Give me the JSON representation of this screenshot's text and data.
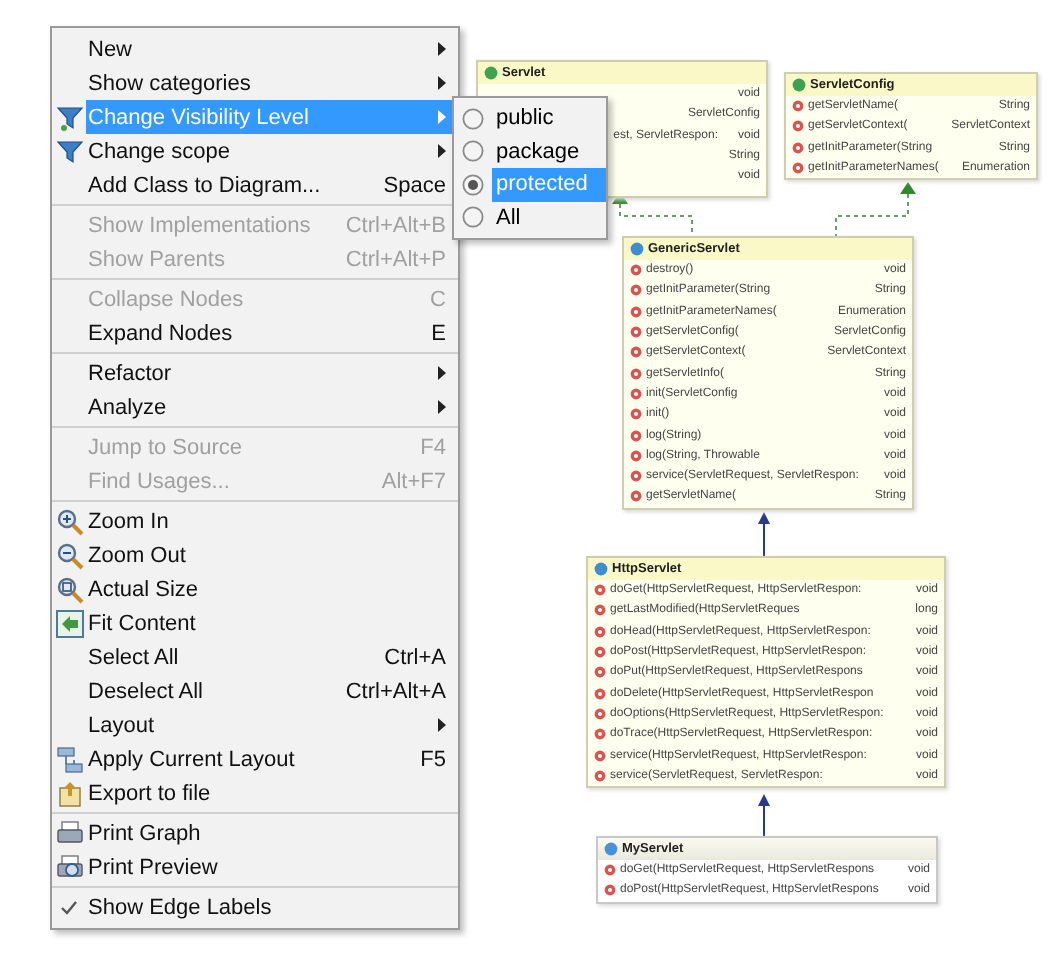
{
  "diagram": {
    "classes": [
      {
        "name": "Servlet",
        "kind": "interface",
        "members": [
          {
            "type": "void"
          },
          {
            "type": "ServletConfig"
          },
          {
            "name": "est, ServletRespon:",
            "type": "void"
          },
          {
            "type": "String"
          },
          {
            "type": "void"
          }
        ]
      },
      {
        "name": "ServletConfig",
        "kind": "interface",
        "members": [
          {
            "name": "getServletName(",
            "type": "String"
          },
          {
            "name": "getServletContext(",
            "type": "ServletContext"
          },
          {
            "name": "getInitParameter(String",
            "type": "String"
          },
          {
            "name": "getInitParameterNames(",
            "type": "Enumeration"
          }
        ]
      },
      {
        "name": "GenericServlet",
        "kind": "abstract",
        "members": [
          {
            "name": "destroy()",
            "type": "void"
          },
          {
            "name": "getInitParameter(String",
            "type": "String"
          },
          {
            "name": "getInitParameterNames(",
            "type": "Enumeration"
          },
          {
            "name": "getServletConfig(",
            "type": "ServletConfig"
          },
          {
            "name": "getServletContext(",
            "type": "ServletContext"
          },
          {
            "name": "getServletInfo(",
            "type": "String"
          },
          {
            "name": "init(ServletConfig",
            "type": "void"
          },
          {
            "name": "init()",
            "type": "void"
          },
          {
            "name": "log(String)",
            "type": "void"
          },
          {
            "name": "log(String, Throwable",
            "type": "void"
          },
          {
            "name": "service(ServletRequest, ServletRespon:",
            "type": "void"
          },
          {
            "name": "getServletName(",
            "type": "String"
          }
        ]
      },
      {
        "name": "HttpServlet",
        "kind": "abstract",
        "members": [
          {
            "name": "doGet(HttpServletRequest, HttpServletRespon:",
            "type": "void"
          },
          {
            "name": "getLastModified(HttpServletReques",
            "type": "long"
          },
          {
            "name": "doHead(HttpServletRequest, HttpServletRespon:",
            "type": "void"
          },
          {
            "name": "doPost(HttpServletRequest, HttpServletRespon:",
            "type": "void"
          },
          {
            "name": "doPut(HttpServletRequest, HttpServletRespons",
            "type": "void"
          },
          {
            "name": "doDelete(HttpServletRequest, HttpServletRespon",
            "type": "void"
          },
          {
            "name": "doOptions(HttpServletRequest, HttpServletRespon:",
            "type": "void"
          },
          {
            "name": "doTrace(HttpServletRequest, HttpServletRespon:",
            "type": "void"
          },
          {
            "name": "service(HttpServletRequest, HttpServletRespon:",
            "type": "void"
          },
          {
            "name": "service(ServletRequest, ServletRespon:",
            "type": "void"
          }
        ]
      },
      {
        "name": "MyServlet",
        "kind": "class",
        "members": [
          {
            "name": "doGet(HttpServletRequest, HttpServletRespons",
            "type": "void"
          },
          {
            "name": "doPost(HttpServletRequest, HttpServletRespons",
            "type": "void"
          }
        ]
      }
    ]
  },
  "context_menu": {
    "items": [
      {
        "kind": "item",
        "label": "New",
        "submenu": true,
        "disabled": false,
        "selected": false
      },
      {
        "kind": "item",
        "label": "Show categories",
        "submenu": true,
        "disabled": false,
        "selected": false
      },
      {
        "kind": "item",
        "label": "Change Visibility Level",
        "submenu": true,
        "disabled": false,
        "selected": true
      },
      {
        "kind": "item",
        "label": "Change scope",
        "submenu": true,
        "disabled": false,
        "selected": false
      },
      {
        "kind": "item",
        "label": "Add Class to Diagram...",
        "shortcut": "Space",
        "submenu": false,
        "disabled": false,
        "selected": false
      },
      {
        "kind": "separator"
      },
      {
        "kind": "item",
        "label": "Show Implementations",
        "shortcut": "Ctrl+Alt+B",
        "submenu": false,
        "disabled": true,
        "selected": false
      },
      {
        "kind": "item",
        "label": "Show Parents",
        "shortcut": "Ctrl+Alt+P",
        "submenu": false,
        "disabled": true,
        "selected": false
      },
      {
        "kind": "separator"
      },
      {
        "kind": "item",
        "label": "Collapse Nodes",
        "shortcut": "C",
        "submenu": false,
        "disabled": true,
        "selected": false
      },
      {
        "kind": "item",
        "label": "Expand Nodes",
        "shortcut": "E",
        "submenu": false,
        "disabled": false,
        "selected": false
      },
      {
        "kind": "separator"
      },
      {
        "kind": "item",
        "label": "Refactor",
        "submenu": true,
        "disabled": false,
        "selected": false
      },
      {
        "kind": "item",
        "label": "Analyze",
        "submenu": true,
        "disabled": false,
        "selected": false
      },
      {
        "kind": "separator"
      },
      {
        "kind": "item",
        "label": "Jump to Source",
        "shortcut": "F4",
        "submenu": false,
        "disabled": true,
        "selected": false
      },
      {
        "kind": "item",
        "label": "Find Usages...",
        "shortcut": "Alt+F7",
        "submenu": false,
        "disabled": true,
        "selected": false
      },
      {
        "kind": "separator"
      },
      {
        "kind": "item",
        "label": "Zoom In",
        "submenu": false,
        "disabled": false,
        "selected": false
      },
      {
        "kind": "item",
        "label": "Zoom Out",
        "submenu": false,
        "disabled": false,
        "selected": false
      },
      {
        "kind": "item",
        "label": "Actual Size",
        "submenu": false,
        "disabled": false,
        "selected": false
      },
      {
        "kind": "item",
        "label": "Fit Content",
        "submenu": false,
        "disabled": false,
        "selected": false
      },
      {
        "kind": "item",
        "label": "Select All",
        "shortcut": "Ctrl+A",
        "submenu": false,
        "disabled": false,
        "selected": false
      },
      {
        "kind": "item",
        "label": "Deselect All",
        "shortcut": "Ctrl+Alt+A",
        "submenu": false,
        "disabled": false,
        "selected": false
      },
      {
        "kind": "item",
        "label": "Layout",
        "submenu": true,
        "disabled": false,
        "selected": false
      },
      {
        "kind": "item",
        "label": "Apply Current Layout",
        "shortcut": "F5",
        "submenu": false,
        "disabled": false,
        "selected": false
      },
      {
        "kind": "item",
        "label": "Export to file",
        "submenu": false,
        "disabled": false,
        "selected": false
      },
      {
        "kind": "separator"
      },
      {
        "kind": "item",
        "label": "Print Graph",
        "submenu": false,
        "disabled": false,
        "selected": false
      },
      {
        "kind": "item",
        "label": "Print Preview",
        "submenu": false,
        "disabled": false,
        "selected": false
      },
      {
        "kind": "separator"
      },
      {
        "kind": "check",
        "label": "Show Edge Labels",
        "checked": true,
        "submenu": false,
        "disabled": false,
        "selected": false
      }
    ]
  },
  "visibility_submenu": {
    "options": [
      {
        "label": "public",
        "checked": false,
        "selected": false
      },
      {
        "label": "package",
        "checked": false,
        "selected": false
      },
      {
        "label": "protected",
        "checked": true,
        "selected": true
      },
      {
        "label": "All",
        "checked": false,
        "selected": false
      }
    ]
  }
}
